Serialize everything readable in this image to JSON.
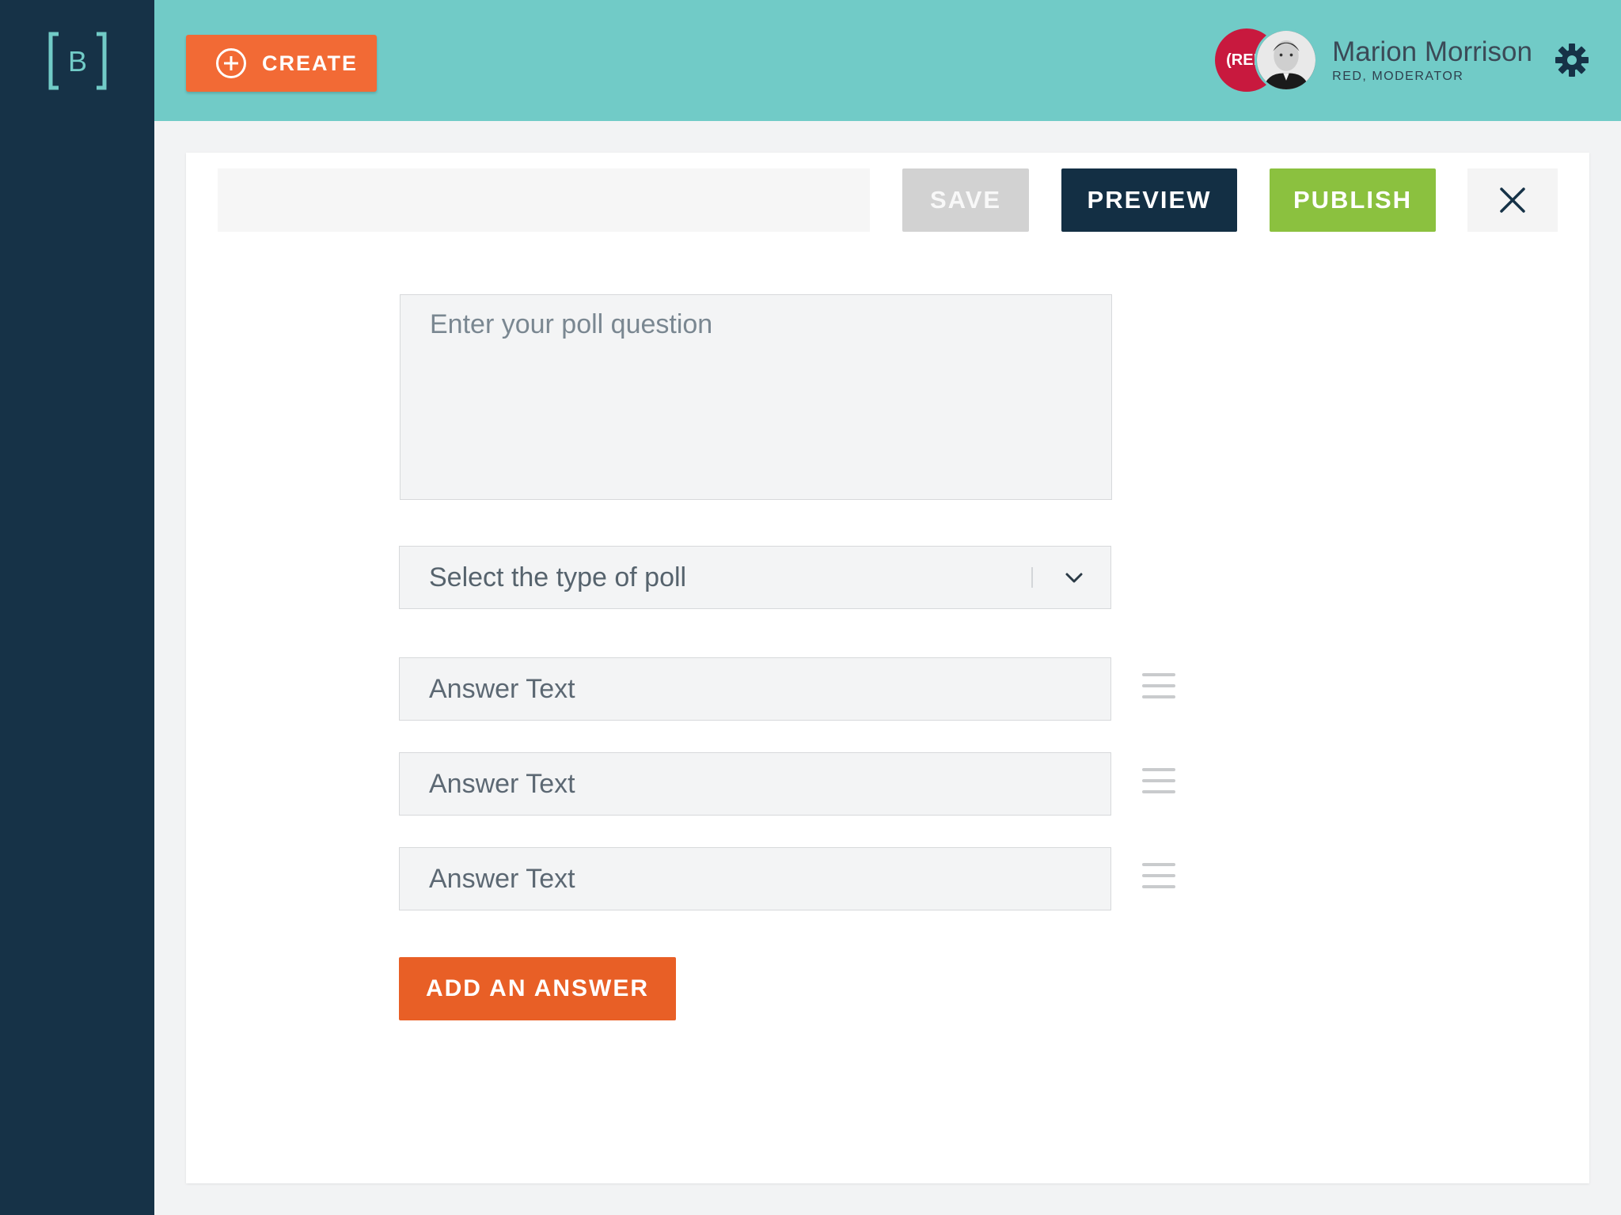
{
  "sidebar": {
    "logo_letter": "B",
    "logo_icon": "bracket-b-logo"
  },
  "header": {
    "create_label": "CREATE",
    "create_icon": "plus-circle-icon",
    "user": {
      "org_badge": "(RED",
      "name": "Marion Morrison",
      "role": "RED, MODERATOR"
    },
    "settings_icon": "gear-icon"
  },
  "toolbar": {
    "title_value": "",
    "save_label": "SAVE",
    "preview_label": "PREVIEW",
    "publish_label": "PUBLISH",
    "close_icon": "close-icon"
  },
  "form": {
    "question_placeholder": "Enter your poll question",
    "poll_type_value": "Select the type of poll",
    "answers": [
      {
        "placeholder": "Answer Text"
      },
      {
        "placeholder": "Answer Text"
      },
      {
        "placeholder": "Answer Text"
      }
    ],
    "add_answer_label": "ADD AN ANSWER"
  },
  "colors": {
    "sidebar": "#163247",
    "topbar": "#71cbc7",
    "create": "#f26a35",
    "save": "#d2d2d2",
    "preview": "#132f44",
    "publish": "#8bc13f",
    "add_answer": "#e85f26"
  }
}
